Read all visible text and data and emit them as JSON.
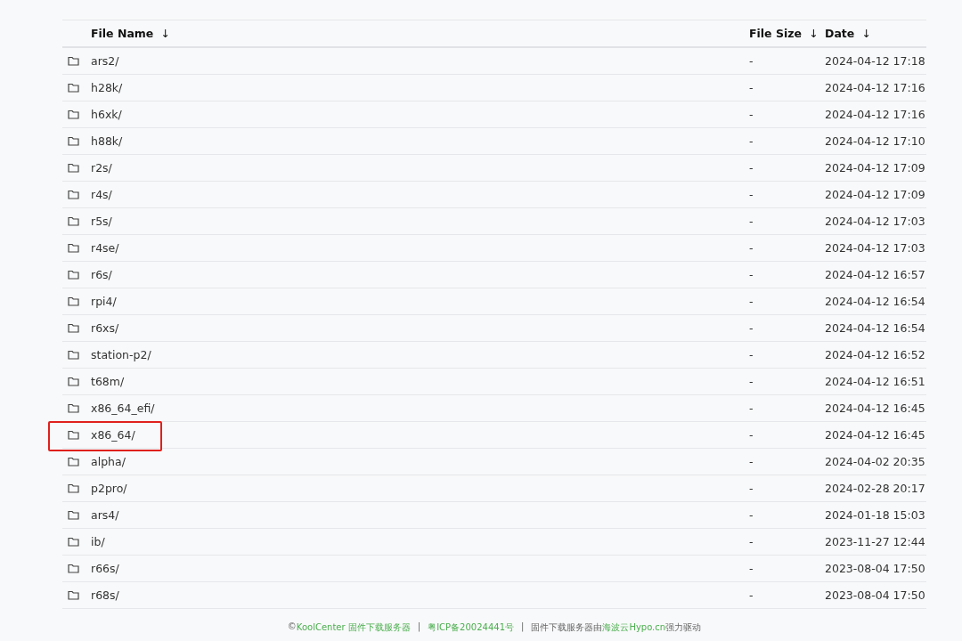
{
  "table": {
    "columns": [
      {
        "label": "File Name",
        "sort": "↓"
      },
      {
        "label": "File Size",
        "sort": "↓"
      },
      {
        "label": "Date",
        "sort": "↓"
      }
    ],
    "rows": [
      {
        "name": "ars2/",
        "size": "-",
        "date": "2024-04-12 17:18",
        "highlighted": false
      },
      {
        "name": "h28k/",
        "size": "-",
        "date": "2024-04-12 17:16",
        "highlighted": false
      },
      {
        "name": "h6xk/",
        "size": "-",
        "date": "2024-04-12 17:16",
        "highlighted": false
      },
      {
        "name": "h88k/",
        "size": "-",
        "date": "2024-04-12 17:10",
        "highlighted": false
      },
      {
        "name": "r2s/",
        "size": "-",
        "date": "2024-04-12 17:09",
        "highlighted": false
      },
      {
        "name": "r4s/",
        "size": "-",
        "date": "2024-04-12 17:09",
        "highlighted": false
      },
      {
        "name": "r5s/",
        "size": "-",
        "date": "2024-04-12 17:03",
        "highlighted": false
      },
      {
        "name": "r4se/",
        "size": "-",
        "date": "2024-04-12 17:03",
        "highlighted": false
      },
      {
        "name": "r6s/",
        "size": "-",
        "date": "2024-04-12 16:57",
        "highlighted": false
      },
      {
        "name": "rpi4/",
        "size": "-",
        "date": "2024-04-12 16:54",
        "highlighted": false
      },
      {
        "name": "r6xs/",
        "size": "-",
        "date": "2024-04-12 16:54",
        "highlighted": false
      },
      {
        "name": "station-p2/",
        "size": "-",
        "date": "2024-04-12 16:52",
        "highlighted": false
      },
      {
        "name": "t68m/",
        "size": "-",
        "date": "2024-04-12 16:51",
        "highlighted": false
      },
      {
        "name": "x86_64_efi/",
        "size": "-",
        "date": "2024-04-12 16:45",
        "highlighted": false
      },
      {
        "name": "x86_64/",
        "size": "-",
        "date": "2024-04-12 16:45",
        "highlighted": true
      },
      {
        "name": "alpha/",
        "size": "-",
        "date": "2024-04-02 20:35",
        "highlighted": false
      },
      {
        "name": "p2pro/",
        "size": "-",
        "date": "2024-02-28 20:17",
        "highlighted": false
      },
      {
        "name": "ars4/",
        "size": "-",
        "date": "2024-01-18 15:03",
        "highlighted": false
      },
      {
        "name": "ib/",
        "size": "-",
        "date": "2023-11-27 12:44",
        "highlighted": false
      },
      {
        "name": "r66s/",
        "size": "-",
        "date": "2023-08-04 17:50",
        "highlighted": false
      },
      {
        "name": "r68s/",
        "size": "-",
        "date": "2023-08-04 17:50",
        "highlighted": false
      }
    ]
  },
  "footer": [
    {
      "kind": "text",
      "text": "©"
    },
    {
      "kind": "link",
      "text": "KoolCenter 固件下载服务器"
    },
    {
      "kind": "separator",
      "text": "|"
    },
    {
      "kind": "link",
      "text": "粤ICP备20024441号"
    },
    {
      "kind": "separator",
      "text": "|"
    },
    {
      "kind": "text",
      "text": "固件下载服务器由"
    },
    {
      "kind": "link",
      "text": "海波云Hypo.cn"
    },
    {
      "kind": "text",
      "text": "强力驱动"
    }
  ]
}
